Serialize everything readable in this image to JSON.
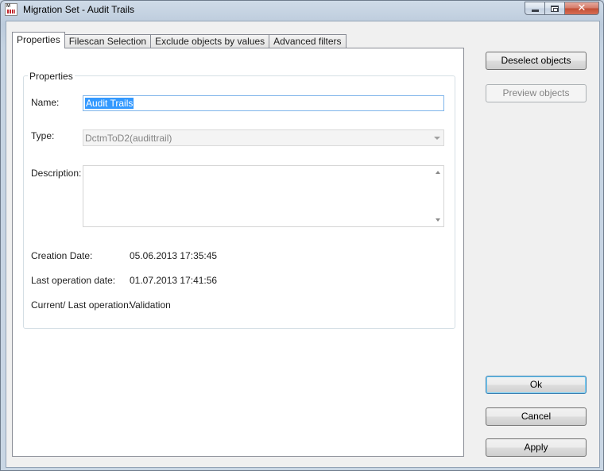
{
  "window": {
    "title": "Migration Set - Audit Trails",
    "app_icon_text": "M"
  },
  "tabs": [
    {
      "label": "Properties",
      "active": true
    },
    {
      "label": "Filescan Selection",
      "active": false
    },
    {
      "label": "Exclude objects by values",
      "active": false
    },
    {
      "label": "Advanced filters",
      "active": false
    }
  ],
  "properties": {
    "group_label": "Properties",
    "name_label": "Name:",
    "name_value": "Audit Trails",
    "type_label": "Type:",
    "type_value": "DctmToD2(audittrail)",
    "description_label": "Description:",
    "description_value": "",
    "creation_date_label": "Creation Date:",
    "creation_date_value": "05.06.2013 17:35:45",
    "last_op_date_label": "Last operation date:",
    "last_op_date_value": "01.07.2013 17:41:56",
    "current_op_label": "Current/ Last operation:",
    "current_op_value": "Validation"
  },
  "buttons": {
    "deselect": "Deselect objects",
    "preview": "Preview objects",
    "ok": "Ok",
    "cancel": "Cancel",
    "apply": "Apply"
  },
  "icons": {
    "minimize": "minimize-icon",
    "maximize": "maximize-icon",
    "close": "close-icon",
    "dropdown": "chevron-down-icon"
  }
}
